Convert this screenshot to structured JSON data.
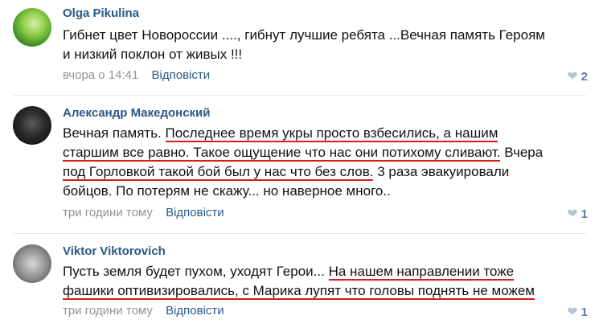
{
  "comments": [
    {
      "author": "Olga Pikulina",
      "text_lines": [
        "Гибнет цвет Новороссии ...., гибнут лучшие ребята ...Вечная память Героям",
        "и низкий поклон от живых !!!"
      ],
      "time": "вчора о 14:41",
      "reply": "Відповісти",
      "likes": "2"
    },
    {
      "author": "Александр Македонский",
      "segments": {
        "s1": "Вечная память. ",
        "s2": "Последнее время укры просто взбесились, а нашим",
        "s3": "старшим все равно. Такое ощущение что нас они потихому сливают.",
        "s4": " Вчера",
        "s5": "под Горловкой такой бой был у нас что без слов.",
        "s6": " 3 раза эвакуировали",
        "s7": "бойцов. По потерям не скажу... но наверное много.."
      },
      "time": "три години тому",
      "reply": "Відповісти",
      "likes": "1"
    },
    {
      "author": "Viktor Viktorovich",
      "segments": {
        "s1": "Пусть земля будет пухом, уходят Герои... ",
        "s2": "На нашем направлении тоже",
        "s3": "фашики оптивизировались, с Марика лупят что головы поднять не можем"
      },
      "time": "три години тому",
      "reply": "Відповісти",
      "likes": "1"
    }
  ]
}
